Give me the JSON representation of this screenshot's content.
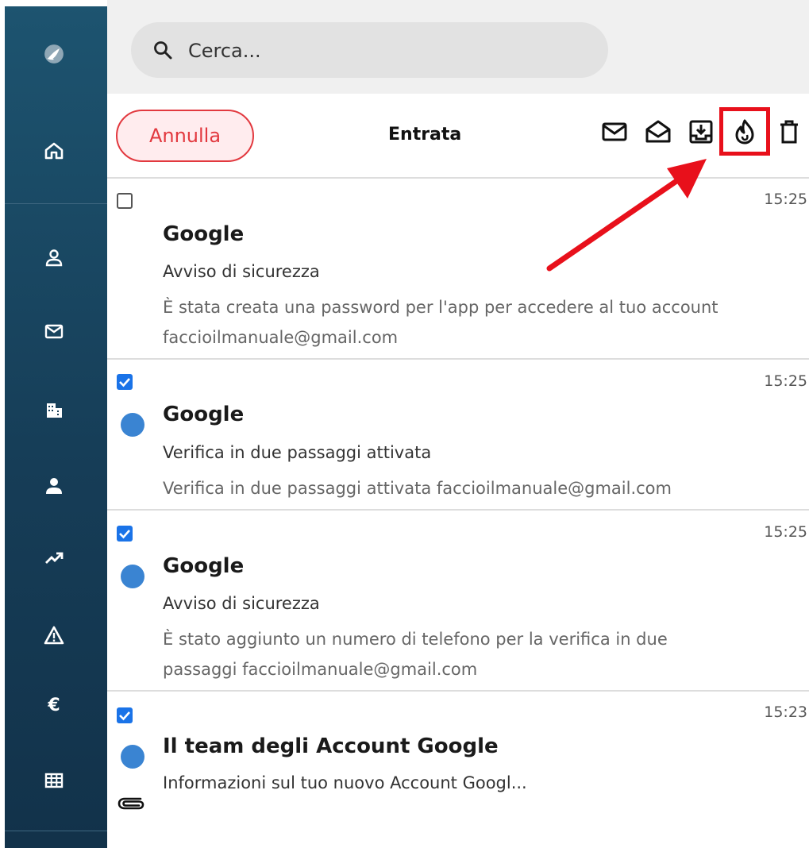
{
  "colors": {
    "sidebar": "#163d57",
    "accent_red": "#e2393f",
    "unread_dot": "#3a84d2",
    "checkbox": "#1a73e8",
    "highlight": "#e8101b"
  },
  "sidebar": {
    "icons": [
      "logo-icon",
      "home-icon",
      "contacts-icon",
      "mail-icon",
      "building-icon",
      "user-icon",
      "trend-icon",
      "warning-icon",
      "euro-icon",
      "grid-icon"
    ]
  },
  "search": {
    "placeholder": "Cerca..."
  },
  "toolbar": {
    "cancel_label": "Annulla",
    "folder_title": "Entrata",
    "actions": [
      "mark-unread-icon",
      "mark-read-icon",
      "archive-icon",
      "spam-flame-icon",
      "trash-icon"
    ]
  },
  "messages": [
    {
      "checked": false,
      "unread": false,
      "time": "15:25",
      "sender": "Google",
      "subject": "Avviso di sicurezza",
      "preview_line1": "È stata creata una password per l'app per accedere al tuo account",
      "preview_line2": "faccioilmanuale@gmail.com"
    },
    {
      "checked": true,
      "unread": true,
      "time": "15:25",
      "sender": "Google",
      "subject": "Verifica in due passaggi attivata",
      "preview_line1": "Verifica in due passaggi attivata faccioilmanuale@gmail.com"
    },
    {
      "checked": true,
      "unread": true,
      "time": "15:25",
      "sender": "Google",
      "subject": "Avviso di sicurezza",
      "preview_line1": "È stato aggiunto un numero di telefono per la verifica in due",
      "preview_line2": "passaggi faccioilmanuale@gmail.com"
    },
    {
      "checked": true,
      "unread": true,
      "has_attachment": true,
      "time": "15:23",
      "sender": "Il team degli Account Google",
      "subject": "Informazioni sul tuo nuovo Account Googl..."
    }
  ]
}
